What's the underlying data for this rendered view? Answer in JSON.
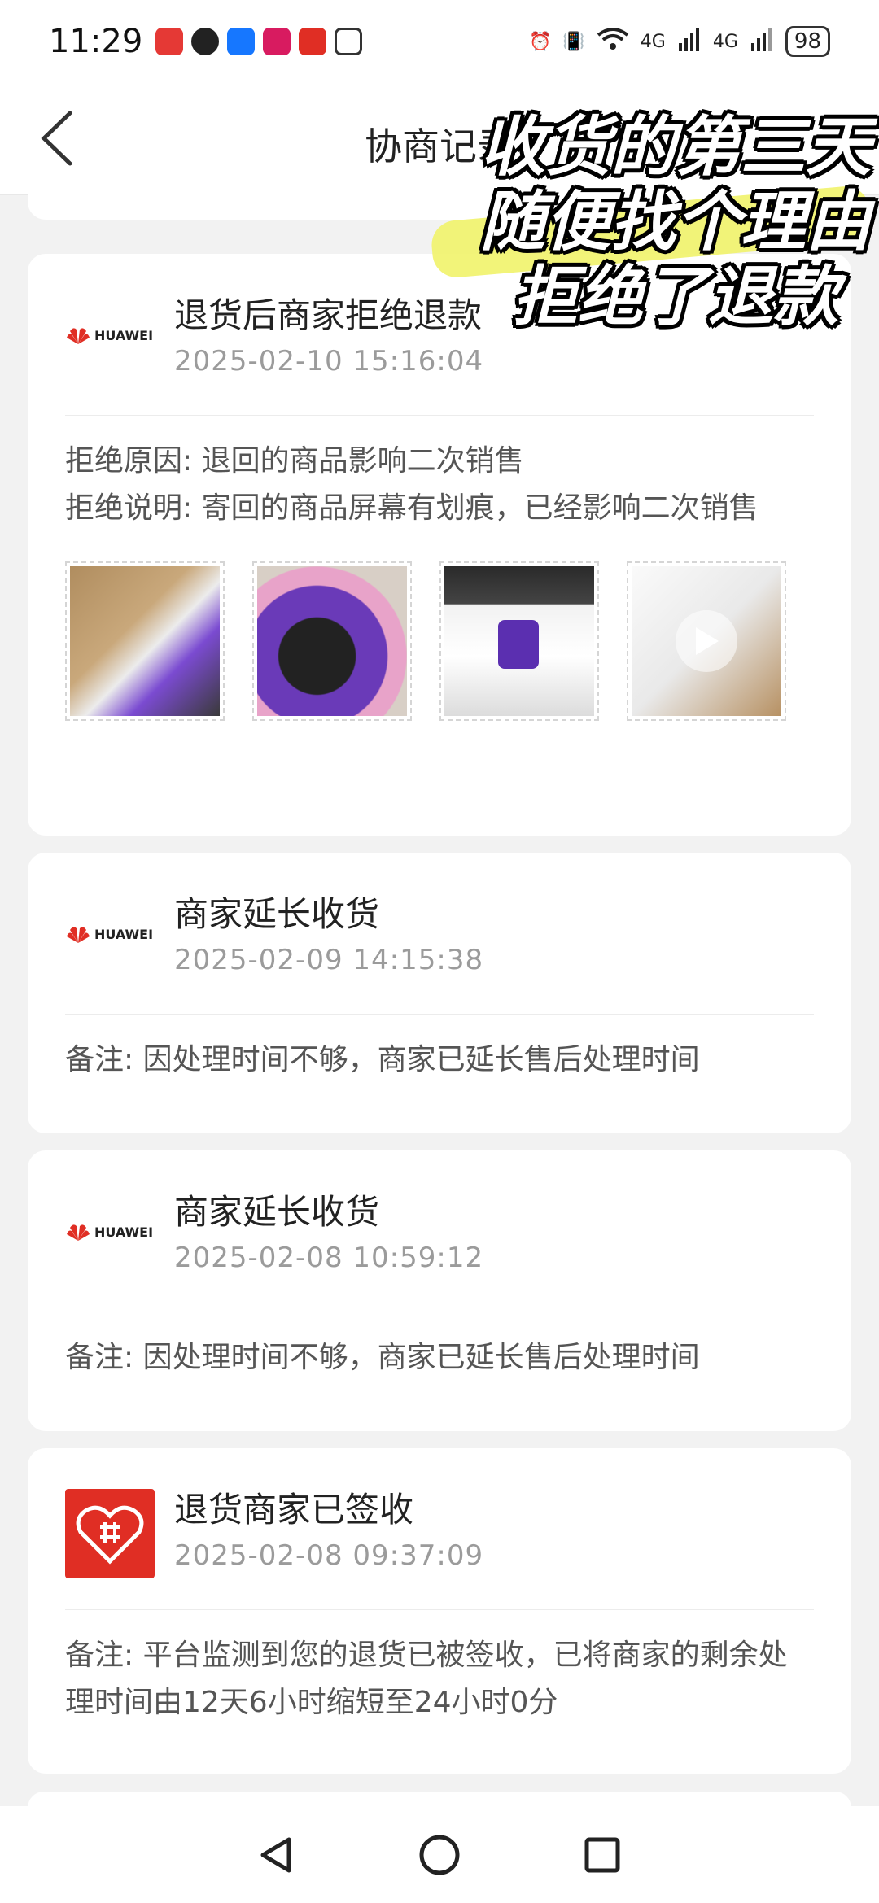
{
  "status_bar": {
    "time": "11:29",
    "network_1": "4G",
    "network_2": "4G",
    "battery": "98"
  },
  "header": {
    "title": "协商记录"
  },
  "overlay_caption": {
    "line1": "收货的第三天",
    "line2": "随便找个理由",
    "line3": "拒绝了退款"
  },
  "events": [
    {
      "title": "退货后商家拒绝退款",
      "time": "2025-02-10 15:16:04",
      "logo": "huawei-logo",
      "reason_label": "拒绝原因: ",
      "reason": "退回的商品影响二次销售",
      "explain_label": "拒绝说明: ",
      "explain": "寄回的商品屏幕有划痕，已经影响二次销售",
      "images": [
        "box-with-watch",
        "watch-closeup",
        "watch-in-box",
        "shipping-label-video"
      ]
    },
    {
      "title": "商家延长收货",
      "time": "2025-02-09 14:15:38",
      "logo": "huawei-logo",
      "note_label": "备注: ",
      "note": "因处理时间不够，商家已延长售后处理时间"
    },
    {
      "title": "商家延长收货",
      "time": "2025-02-08 10:59:12",
      "logo": "huawei-logo",
      "note_label": "备注: ",
      "note": "因处理时间不够，商家已延长售后处理时间"
    },
    {
      "title": "退货商家已签收",
      "time": "2025-02-08 09:37:09",
      "logo": "pinduoduo-logo",
      "note_label": "备注: ",
      "note": "平台监测到您的退货已被签收，已将商家的剩余处理时间由12天6小时缩短至24小时0分"
    }
  ],
  "brand": {
    "huawei_text": "HUAWEI"
  },
  "colors": {
    "accent_red": "#e02e24",
    "background": "#f2f2f2",
    "muted": "#9b9b9b"
  },
  "icons": {
    "back": "back-chevron-icon",
    "nav_back": "nav-back-icon",
    "nav_home": "nav-home-icon",
    "nav_recents": "nav-recents-icon"
  }
}
